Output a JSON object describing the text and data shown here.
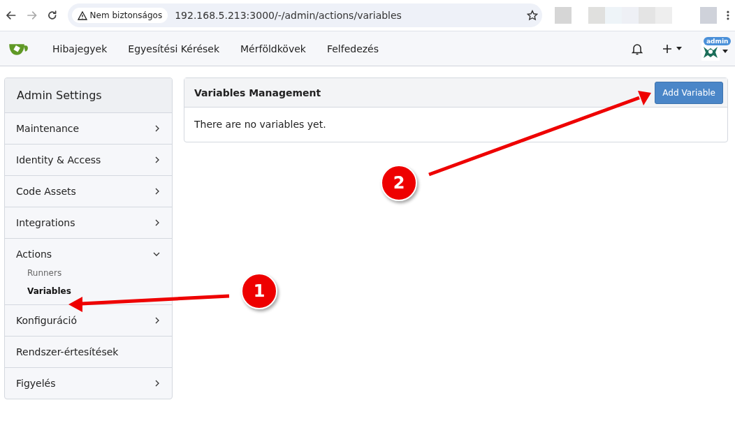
{
  "browser": {
    "security_label": "Nem biztonságos",
    "url": "192.168.5.213:3000/-/admin/actions/variables"
  },
  "nav": {
    "links": [
      "Hibajegyek",
      "Egyesítési Kérések",
      "Mérföldkövek",
      "Felfedezés"
    ],
    "user_badge": "admin"
  },
  "sidebar": {
    "title": "Admin Settings",
    "items": [
      {
        "label": "Maintenance",
        "kind": "group",
        "expanded": false
      },
      {
        "label": "Identity & Access",
        "kind": "group",
        "expanded": false
      },
      {
        "label": "Code Assets",
        "kind": "group",
        "expanded": false
      },
      {
        "label": "Integrations",
        "kind": "group",
        "expanded": false
      },
      {
        "label": "Actions",
        "kind": "group",
        "expanded": true,
        "children": [
          {
            "label": "Runners",
            "selected": false
          },
          {
            "label": "Variables",
            "selected": true
          }
        ]
      },
      {
        "label": "Konfiguráció",
        "kind": "group",
        "expanded": false
      },
      {
        "label": "Rendszer-értesítések",
        "kind": "link"
      },
      {
        "label": "Figyelés",
        "kind": "group",
        "expanded": false
      }
    ]
  },
  "panel": {
    "title": "Variables Management",
    "button": "Add Variable",
    "empty_message": "There are no variables yet."
  },
  "annotations": [
    {
      "number": "1"
    },
    {
      "number": "2"
    }
  ]
}
